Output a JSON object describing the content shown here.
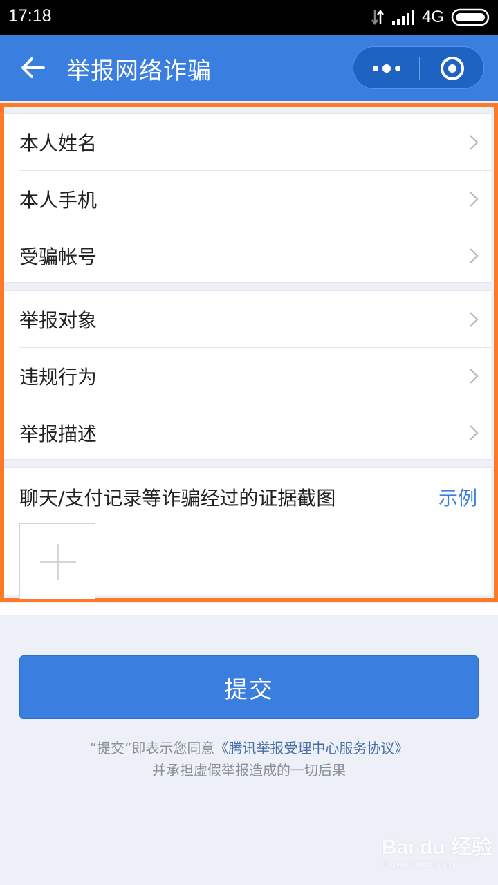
{
  "status_bar": {
    "time": "17:18",
    "network": "4G",
    "icons": [
      "data-arrows-icon",
      "signal-bars-icon",
      "battery-icon"
    ]
  },
  "nav": {
    "title": "举报网络诈骗",
    "back_icon": "back-arrow-icon",
    "more_icon": "more-dots-icon",
    "close_icon": "target-close-icon"
  },
  "form": {
    "personal": [
      {
        "label": "本人姓名"
      },
      {
        "label": "本人手机"
      },
      {
        "label": "受骗帐号"
      }
    ],
    "report": [
      {
        "label": "举报对象"
      },
      {
        "label": "违规行为"
      },
      {
        "label": "举报描述"
      }
    ],
    "evidence": {
      "label": "聊天/支付记录等诈骗经过的证据截图",
      "example_link": "示例"
    }
  },
  "submit": {
    "label": "提交"
  },
  "agreement": {
    "prefix": "“提交”即表示您同意",
    "link": "《腾讯举报受理中心服务协议》",
    "line2": "并承担虚假举报造成的一切后果"
  },
  "watermark": {
    "main": "Bai du 经验",
    "sub": "jingyan.baidu.com"
  },
  "colors": {
    "primary": "#3a7ee0",
    "highlight": "#ff7a26",
    "background": "#edf0f7"
  }
}
